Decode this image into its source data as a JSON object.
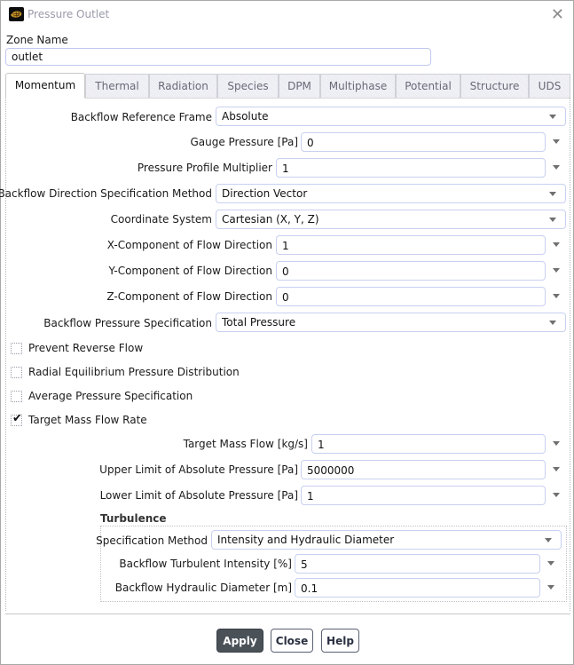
{
  "window": {
    "title": "Pressure Outlet",
    "icon": "fluent-app-icon",
    "close_icon": "close-icon"
  },
  "zone": {
    "label": "Zone Name",
    "value": "outlet"
  },
  "tabs": [
    {
      "label": "Momentum",
      "active": true
    },
    {
      "label": "Thermal",
      "active": false
    },
    {
      "label": "Radiation",
      "active": false
    },
    {
      "label": "Species",
      "active": false
    },
    {
      "label": "DPM",
      "active": false
    },
    {
      "label": "Multiphase",
      "active": false
    },
    {
      "label": "Potential",
      "active": false
    },
    {
      "label": "Structure",
      "active": false
    },
    {
      "label": "UDS",
      "active": false
    }
  ],
  "momentum": {
    "backflow_reference_frame": {
      "label": "Backflow Reference Frame",
      "value": "Absolute"
    },
    "gauge_pressure": {
      "label": "Gauge Pressure [Pa]",
      "value": "0"
    },
    "pressure_profile_multiplier": {
      "label": "Pressure Profile Multiplier",
      "value": "1"
    },
    "backflow_direction_method": {
      "label": "Backflow Direction Specification Method",
      "value": "Direction Vector"
    },
    "coordinate_system": {
      "label": "Coordinate System",
      "value": "Cartesian (X, Y, Z)"
    },
    "x_component": {
      "label": "X-Component of Flow Direction",
      "value": "1"
    },
    "y_component": {
      "label": "Y-Component of Flow Direction",
      "value": "0"
    },
    "z_component": {
      "label": "Z-Component of Flow Direction",
      "value": "0"
    },
    "backflow_pressure_spec": {
      "label": "Backflow Pressure Specification",
      "value": "Total Pressure"
    },
    "checkboxes": [
      {
        "label": "Prevent Reverse Flow",
        "checked": false
      },
      {
        "label": "Radial Equilibrium Pressure Distribution",
        "checked": false
      },
      {
        "label": "Average Pressure Specification",
        "checked": false
      },
      {
        "label": "Target Mass Flow Rate",
        "checked": true
      }
    ],
    "target_mass_flow": {
      "label": "Target Mass Flow [kg/s]",
      "value": "1"
    },
    "upper_limit": {
      "label": "Upper Limit of Absolute Pressure [Pa]",
      "value": "5000000"
    },
    "lower_limit": {
      "label": "Lower Limit of Absolute Pressure [Pa]",
      "value": "1"
    }
  },
  "turbulence": {
    "title": "Turbulence",
    "specification_method": {
      "label": "Specification Method",
      "value": "Intensity and Hydraulic Diameter"
    },
    "turbulent_intensity": {
      "label": "Backflow Turbulent Intensity [%]",
      "value": "5"
    },
    "hydraulic_diameter": {
      "label": "Backflow Hydraulic Diameter [m]",
      "value": "0.1"
    }
  },
  "buttons": {
    "apply": "Apply",
    "close": "Close",
    "help": "Help"
  },
  "colors": {
    "primary_button": "#4a5258",
    "field_border": "#c8d0f0",
    "title_text": "#9a9aaa"
  }
}
